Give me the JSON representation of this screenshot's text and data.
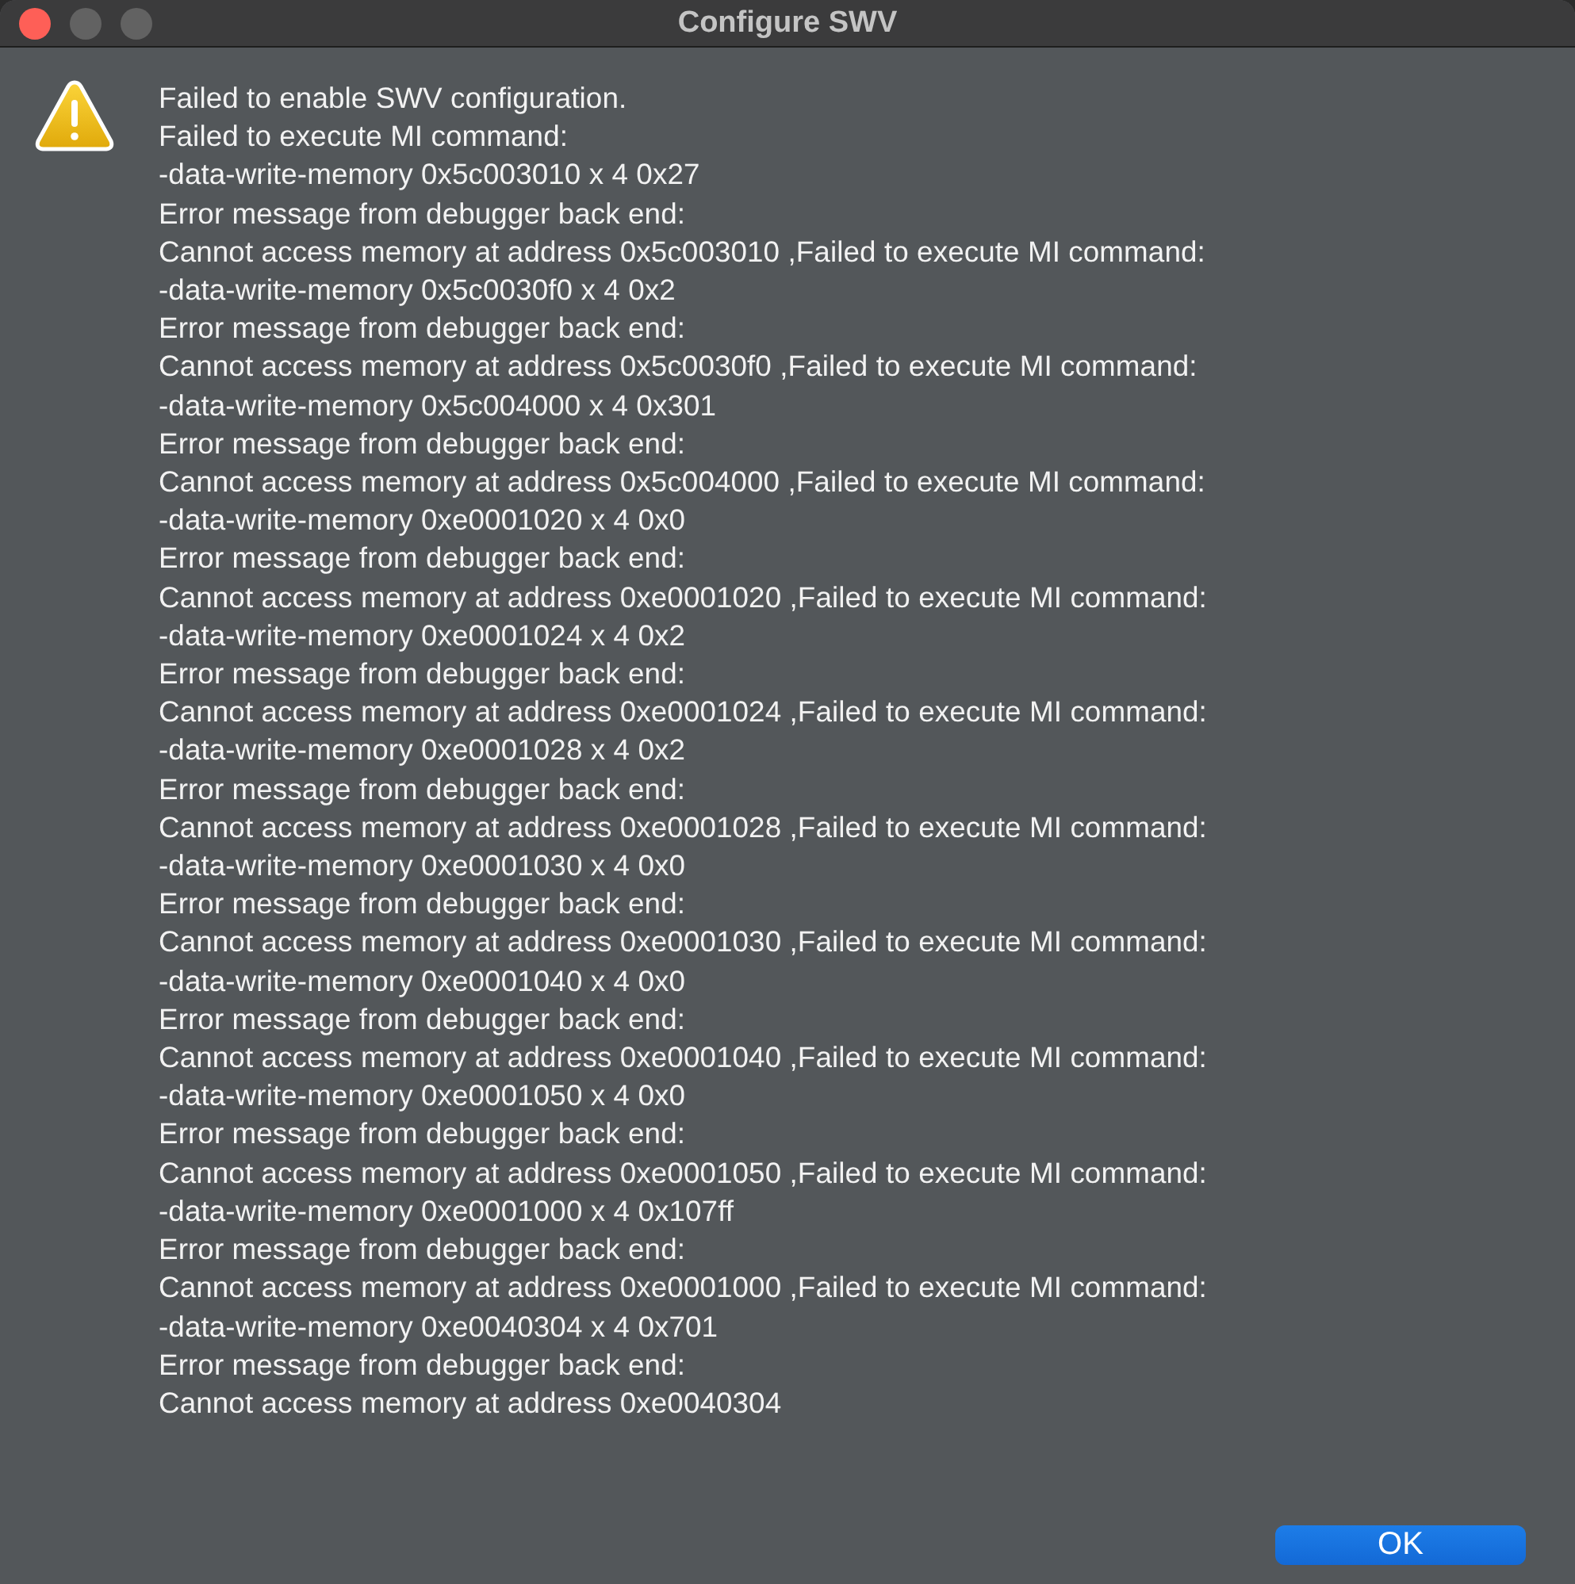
{
  "window": {
    "title": "Configure SWV",
    "controls": [
      {
        "kind": "close",
        "disabled": false
      },
      {
        "kind": "minimize",
        "disabled": true
      },
      {
        "kind": "zoom",
        "disabled": true
      }
    ]
  },
  "dialog": {
    "icon": {
      "kind": "warning"
    },
    "message": "Failed to enable SWV configuration.\nFailed to execute MI command:\n-data-write-memory 0x5c003010 x 4 0x27\nError message from debugger back end:\nCannot access memory at address 0x5c003010 ,Failed to execute MI command:\n-data-write-memory 0x5c0030f0 x 4 0x2\nError message from debugger back end:\nCannot access memory at address 0x5c0030f0 ,Failed to execute MI command:\n-data-write-memory 0x5c004000 x 4 0x301\nError message from debugger back end:\nCannot access memory at address 0x5c004000 ,Failed to execute MI command:\n-data-write-memory 0xe0001020 x 4 0x0\nError message from debugger back end:\nCannot access memory at address 0xe0001020 ,Failed to execute MI command:\n-data-write-memory 0xe0001024 x 4 0x2\nError message from debugger back end:\nCannot access memory at address 0xe0001024 ,Failed to execute MI command:\n-data-write-memory 0xe0001028 x 4 0x2\nError message from debugger back end:\nCannot access memory at address 0xe0001028 ,Failed to execute MI command:\n-data-write-memory 0xe0001030 x 4 0x0\nError message from debugger back end:\nCannot access memory at address 0xe0001030 ,Failed to execute MI command:\n-data-write-memory 0xe0001040 x 4 0x0\nError message from debugger back end:\nCannot access memory at address 0xe0001040 ,Failed to execute MI command:\n-data-write-memory 0xe0001050 x 4 0x0\nError message from debugger back end:\nCannot access memory at address 0xe0001050 ,Failed to execute MI command:\n-data-write-memory 0xe0001000 x 4 0x107ff\nError message from debugger back end:\nCannot access memory at address 0xe0001000 ,Failed to execute MI command:\n-data-write-memory 0xe0040304 x 4 0x701\nError message from debugger back end:\nCannot access memory at address 0xe0040304"
  },
  "buttons": [
    {
      "label": "OK",
      "default": true
    }
  ]
}
